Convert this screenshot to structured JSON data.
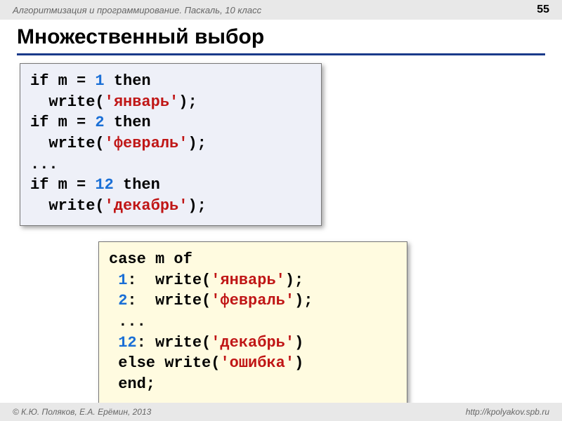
{
  "header": {
    "breadcrumb": "Алгоритмизация и программирование. Паскаль, 10 класс",
    "page_number": "55"
  },
  "title": "Множественный выбор",
  "code_block_if": [
    {
      "segments": [
        {
          "t": "if m = ",
          "c": "plain"
        },
        {
          "t": "1",
          "c": "num"
        },
        {
          "t": " then",
          "c": "plain"
        }
      ]
    },
    {
      "segments": [
        {
          "t": "  write(",
          "c": "plain"
        },
        {
          "t": "'январь'",
          "c": "str"
        },
        {
          "t": ");",
          "c": "plain"
        }
      ]
    },
    {
      "segments": [
        {
          "t": "if m = ",
          "c": "plain"
        },
        {
          "t": "2",
          "c": "num"
        },
        {
          "t": " then",
          "c": "plain"
        }
      ]
    },
    {
      "segments": [
        {
          "t": "  write(",
          "c": "plain"
        },
        {
          "t": "'февраль'",
          "c": "str"
        },
        {
          "t": ");",
          "c": "plain"
        }
      ]
    },
    {
      "segments": [
        {
          "t": "...",
          "c": "plain"
        }
      ]
    },
    {
      "segments": [
        {
          "t": "if m = ",
          "c": "plain"
        },
        {
          "t": "12",
          "c": "num"
        },
        {
          "t": " then",
          "c": "plain"
        }
      ]
    },
    {
      "segments": [
        {
          "t": "  write(",
          "c": "plain"
        },
        {
          "t": "'декабрь'",
          "c": "str"
        },
        {
          "t": ");",
          "c": "plain"
        }
      ]
    }
  ],
  "code_block_case": [
    {
      "segments": [
        {
          "t": "case m of",
          "c": "plain"
        }
      ]
    },
    {
      "segments": [
        {
          "t": " ",
          "c": "plain"
        },
        {
          "t": "1",
          "c": "num"
        },
        {
          "t": ":  write(",
          "c": "plain"
        },
        {
          "t": "'январь'",
          "c": "str"
        },
        {
          "t": ");",
          "c": "plain"
        }
      ]
    },
    {
      "segments": [
        {
          "t": " ",
          "c": "plain"
        },
        {
          "t": "2",
          "c": "num"
        },
        {
          "t": ":  write(",
          "c": "plain"
        },
        {
          "t": "'февраль'",
          "c": "str"
        },
        {
          "t": ");",
          "c": "plain"
        }
      ]
    },
    {
      "segments": [
        {
          "t": " ...",
          "c": "plain"
        }
      ]
    },
    {
      "segments": [
        {
          "t": " ",
          "c": "plain"
        },
        {
          "t": "12",
          "c": "num"
        },
        {
          "t": ": write(",
          "c": "plain"
        },
        {
          "t": "'декабрь'",
          "c": "str"
        },
        {
          "t": ")",
          "c": "plain"
        }
      ]
    },
    {
      "segments": [
        {
          "t": " else write(",
          "c": "plain"
        },
        {
          "t": "'ошибка'",
          "c": "str"
        },
        {
          "t": ")",
          "c": "plain"
        }
      ]
    },
    {
      "segments": [
        {
          "t": " end;",
          "c": "plain"
        }
      ]
    }
  ],
  "footer": {
    "copyright": "© К.Ю. Поляков, Е.А. Ерёмин, 2013",
    "url": "http://kpolyakov.spb.ru"
  }
}
